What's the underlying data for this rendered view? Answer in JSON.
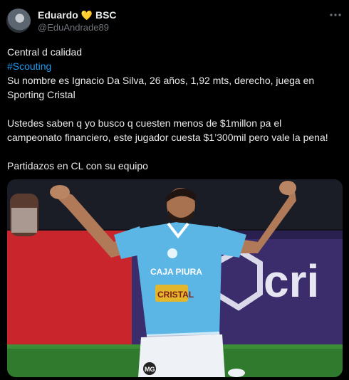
{
  "tweet": {
    "author": {
      "display_name": "Eduardo",
      "emoji": "💛",
      "team": "BSC",
      "handle": "@EduAndrade89",
      "avatar_icon": "profile-avatar"
    },
    "more_icon": "more-horizontal-icon",
    "lines": [
      "Central d calidad",
      "#Scouting",
      "Su nombre es Ignacio Da Silva, 26 años, 1,92 mts, derecho, juega en",
      "Sporting Cristal",
      "",
      "Ustedes saben q yo busco q cuesten menos de $1millon pa el",
      "campeonato financiero, este jugador cuesta $1’300mil pero vale la pena!",
      "",
      "Partidazos en CL con su equipo"
    ],
    "media": {
      "sponsor_1": "CAJA PIURA",
      "sponsor_2": "CRISTAL",
      "shorts_logo": "MG",
      "board_text": "cri"
    }
  },
  "colors": {
    "background": "#000000",
    "text": "#e7e9ea",
    "muted": "#71767b",
    "link": "#1d9bf0",
    "jersey": "#5bb6e6"
  }
}
